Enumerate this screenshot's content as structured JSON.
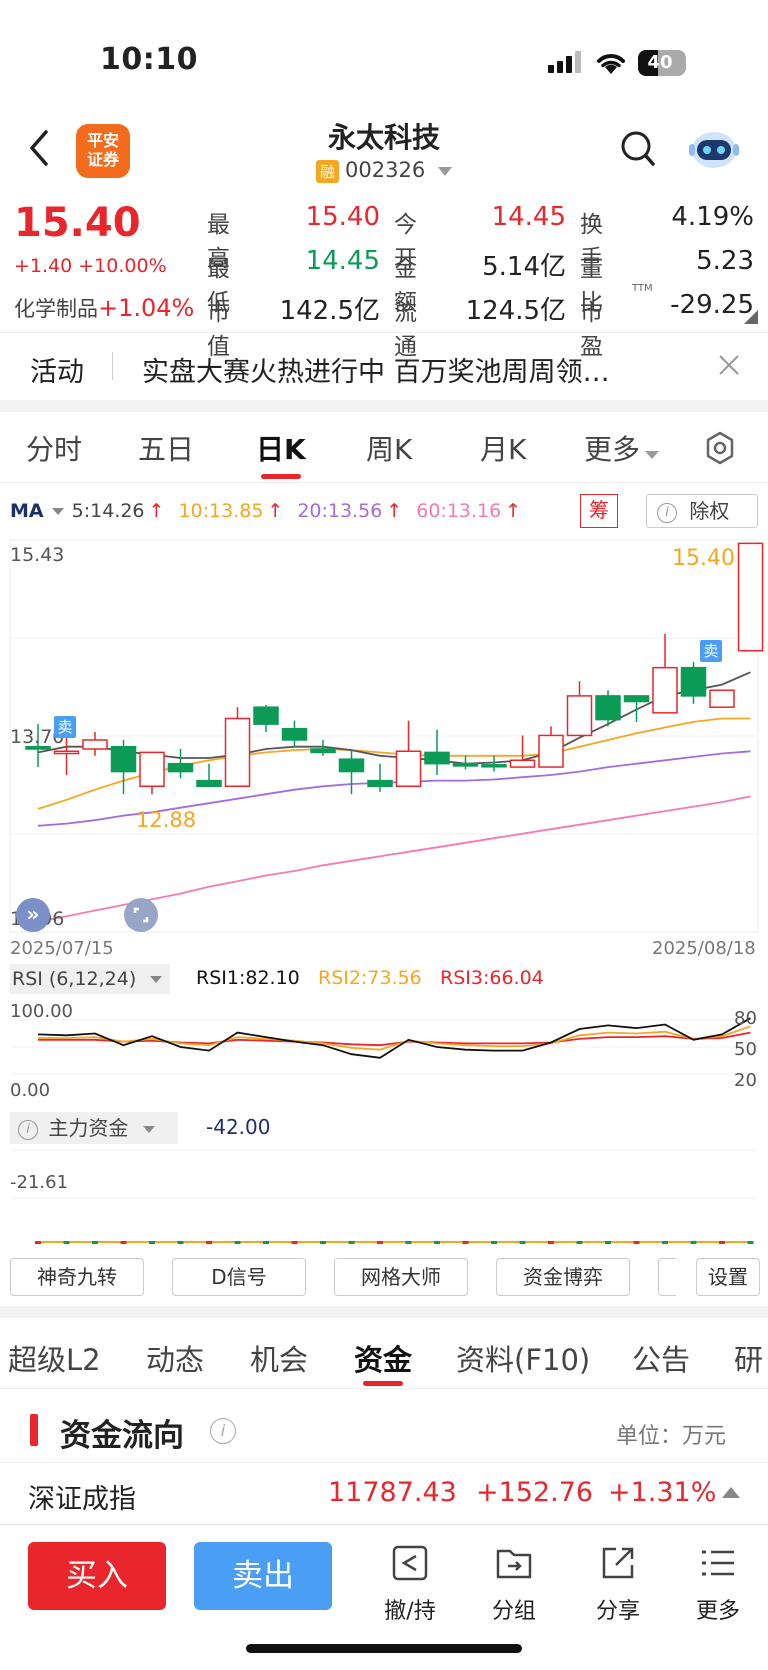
{
  "status_bar": {
    "time": "10:10",
    "battery": "40"
  },
  "header": {
    "title": "永太科技",
    "margin_badge": "融",
    "code": "002326",
    "logo_line1": "平安",
    "logo_line2": "证券"
  },
  "quote": {
    "price": "15.40",
    "change": "+1.40 +10.00%",
    "sector": "化学制品",
    "sector_change": "+1.04%",
    "fields": [
      {
        "label": "最高",
        "value": "15.40"
      },
      {
        "label": "今开",
        "value": "14.45"
      },
      {
        "label": "换手",
        "value": "4.19%"
      },
      {
        "label": "最低",
        "value": "14.45"
      },
      {
        "label": "金额",
        "value": "5.14亿"
      },
      {
        "label": "量比",
        "value": "5.23"
      },
      {
        "label": "市值",
        "value": "142.5亿"
      },
      {
        "label": "流通",
        "value": "124.5亿"
      },
      {
        "label": "市盈",
        "value": "-29.25",
        "sup": "TTM"
      }
    ]
  },
  "banner": {
    "tag": "活动",
    "text": "实盘大赛火热进行中 百万奖池周周领…"
  },
  "ktabs": {
    "t1": "分时",
    "t2": "五日",
    "t3": "日K",
    "t4": "周K",
    "t5": "月K",
    "t6": "更多"
  },
  "ma_legend": {
    "label": "MA",
    "ma5": "5:14.26",
    "ma10": "10:13.85",
    "ma20": "20:13.56",
    "ma60": "60:13.16",
    "chip": "筹",
    "exright": "除权"
  },
  "colors": {
    "up": "#e8262c",
    "down": "#0b9b57",
    "ma5": "#555555",
    "ma10": "#f5a623",
    "ma20": "#a36be0",
    "ma60": "#f27bb5",
    "accent": "#e8262c",
    "sell_blue": "#4a9ff5"
  },
  "chart_data": {
    "type": "candlestick",
    "title": "",
    "y_labels": {
      "top": "15.43",
      "mid": "13.70",
      "bottom": "11.96"
    },
    "ylim": [
      11.96,
      15.43
    ],
    "date_start": "2025/07/15",
    "date_end": "2025/08/18",
    "annotations": {
      "last_price": "15.40",
      "low_mark": "12.88",
      "sell": "卖"
    },
    "candles": [
      {
        "o": 13.6,
        "h": 13.8,
        "l": 13.42,
        "c": 13.58
      },
      {
        "o": 13.54,
        "h": 13.7,
        "l": 13.35,
        "c": 13.56
      },
      {
        "o": 13.58,
        "h": 13.73,
        "l": 13.52,
        "c": 13.66
      },
      {
        "o": 13.6,
        "h": 13.66,
        "l": 13.18,
        "c": 13.38
      },
      {
        "o": 13.25,
        "h": 13.55,
        "l": 13.18,
        "c": 13.55
      },
      {
        "o": 13.45,
        "h": 13.58,
        "l": 13.32,
        "c": 13.38
      },
      {
        "o": 13.3,
        "h": 13.45,
        "l": 13.25,
        "c": 13.25
      },
      {
        "o": 13.25,
        "h": 13.95,
        "l": 13.25,
        "c": 13.85
      },
      {
        "o": 13.95,
        "h": 13.97,
        "l": 13.73,
        "c": 13.8
      },
      {
        "o": 13.76,
        "h": 13.83,
        "l": 13.6,
        "c": 13.66
      },
      {
        "o": 13.58,
        "h": 13.66,
        "l": 13.52,
        "c": 13.55
      },
      {
        "o": 13.49,
        "h": 13.57,
        "l": 13.18,
        "c": 13.38
      },
      {
        "o": 13.3,
        "h": 13.45,
        "l": 13.2,
        "c": 13.25
      },
      {
        "o": 13.25,
        "h": 13.83,
        "l": 13.25,
        "c": 13.56
      },
      {
        "o": 13.55,
        "h": 13.75,
        "l": 13.35,
        "c": 13.45
      },
      {
        "o": 13.45,
        "h": 13.52,
        "l": 13.4,
        "c": 13.43
      },
      {
        "o": 13.44,
        "h": 13.52,
        "l": 13.38,
        "c": 13.43
      },
      {
        "o": 13.42,
        "h": 13.7,
        "l": 13.42,
        "c": 13.48
      },
      {
        "o": 13.42,
        "h": 13.78,
        "l": 13.42,
        "c": 13.7
      },
      {
        "o": 13.7,
        "h": 14.18,
        "l": 13.7,
        "c": 14.05
      },
      {
        "o": 14.05,
        "h": 14.1,
        "l": 13.78,
        "c": 13.84
      },
      {
        "o": 14.05,
        "h": 14.0,
        "l": 13.82,
        "c": 14.0
      },
      {
        "o": 13.9,
        "h": 14.6,
        "l": 13.9,
        "c": 14.3
      },
      {
        "o": 14.3,
        "h": 14.35,
        "l": 13.98,
        "c": 14.05
      },
      {
        "o": 13.95,
        "h": 14.1,
        "l": 13.95,
        "c": 14.1
      },
      {
        "o": 14.45,
        "h": 15.4,
        "l": 14.45,
        "c": 15.4
      }
    ],
    "ma5": [
      13.55,
      13.6,
      13.6,
      13.56,
      13.53,
      13.5,
      13.5,
      13.53,
      13.58,
      13.6,
      13.6,
      13.57,
      13.52,
      13.5,
      13.48,
      13.45,
      13.46,
      13.48,
      13.55,
      13.68,
      13.8,
      13.93,
      14.05,
      14.1,
      14.15,
      14.26
    ],
    "ma10": [
      13.05,
      13.13,
      13.22,
      13.3,
      13.37,
      13.43,
      13.48,
      13.52,
      13.55,
      13.57,
      13.58,
      13.57,
      13.55,
      13.53,
      13.52,
      13.52,
      13.52,
      13.52,
      13.54,
      13.6,
      13.66,
      13.72,
      13.77,
      13.82,
      13.85,
      13.85
    ],
    "ma20": [
      12.9,
      12.92,
      12.95,
      12.99,
      13.02,
      13.06,
      13.1,
      13.14,
      13.18,
      13.22,
      13.25,
      13.27,
      13.28,
      13.29,
      13.3,
      13.3,
      13.31,
      13.33,
      13.35,
      13.38,
      13.42,
      13.45,
      13.48,
      13.51,
      13.54,
      13.56
    ],
    "ma60": [
      12.05,
      12.1,
      12.15,
      12.2,
      12.25,
      12.3,
      12.36,
      12.41,
      12.46,
      12.5,
      12.55,
      12.59,
      12.63,
      12.67,
      12.71,
      12.75,
      12.79,
      12.83,
      12.87,
      12.91,
      12.95,
      12.99,
      13.03,
      13.07,
      13.11,
      13.16
    ]
  },
  "rsi": {
    "label": "RSI (6,12,24)",
    "rsi1": "RSI1:82.10",
    "rsi2": "RSI2:73.56",
    "rsi3": "RSI3:66.04",
    "top": "100.00",
    "bottom": "0.00",
    "r80": "80",
    "r50": "50",
    "r20": "20",
    "rsi1_values": [
      64,
      63,
      65,
      52,
      62,
      50,
      46,
      66,
      61,
      56,
      52,
      42,
      38,
      58,
      50,
      47,
      46,
      46,
      55,
      70,
      74,
      71,
      75,
      58,
      64,
      82
    ],
    "rsi2_values": [
      60,
      60,
      61,
      56,
      59,
      54,
      52,
      61,
      59,
      57,
      54,
      49,
      47,
      57,
      54,
      52,
      51,
      51,
      54,
      63,
      66,
      65,
      67,
      59,
      62,
      73
    ],
    "rsi3_values": [
      58,
      58,
      58,
      56,
      57,
      55,
      54,
      58,
      57,
      56,
      55,
      53,
      52,
      56,
      55,
      54,
      54,
      54,
      55,
      59,
      61,
      61,
      62,
      59,
      60,
      66
    ]
  },
  "capital": {
    "label": "主力资金",
    "value": "-42.00",
    "scale": "-21.61"
  },
  "tool_buttons": {
    "b1": "神奇九转",
    "b2": "D信号",
    "b3": "网格大师",
    "b4": "资金博弈",
    "b5": "设置"
  },
  "ftabs": {
    "f1": "超级L2",
    "f2": "动态",
    "f3": "机会",
    "f4": "资金",
    "f5": "资料(F10)",
    "f6": "公告",
    "f7": "研"
  },
  "flow": {
    "title": "资金流向",
    "unit": "单位：万元",
    "index_name": "深证成指",
    "index_value": "11787.43",
    "index_change": "+152.76",
    "index_pct": "+1.31%"
  },
  "actions": {
    "buy": "买入",
    "sell": "卖出",
    "a1": "撤/持",
    "a2": "分组",
    "a3": "分享",
    "a4": "更多"
  }
}
